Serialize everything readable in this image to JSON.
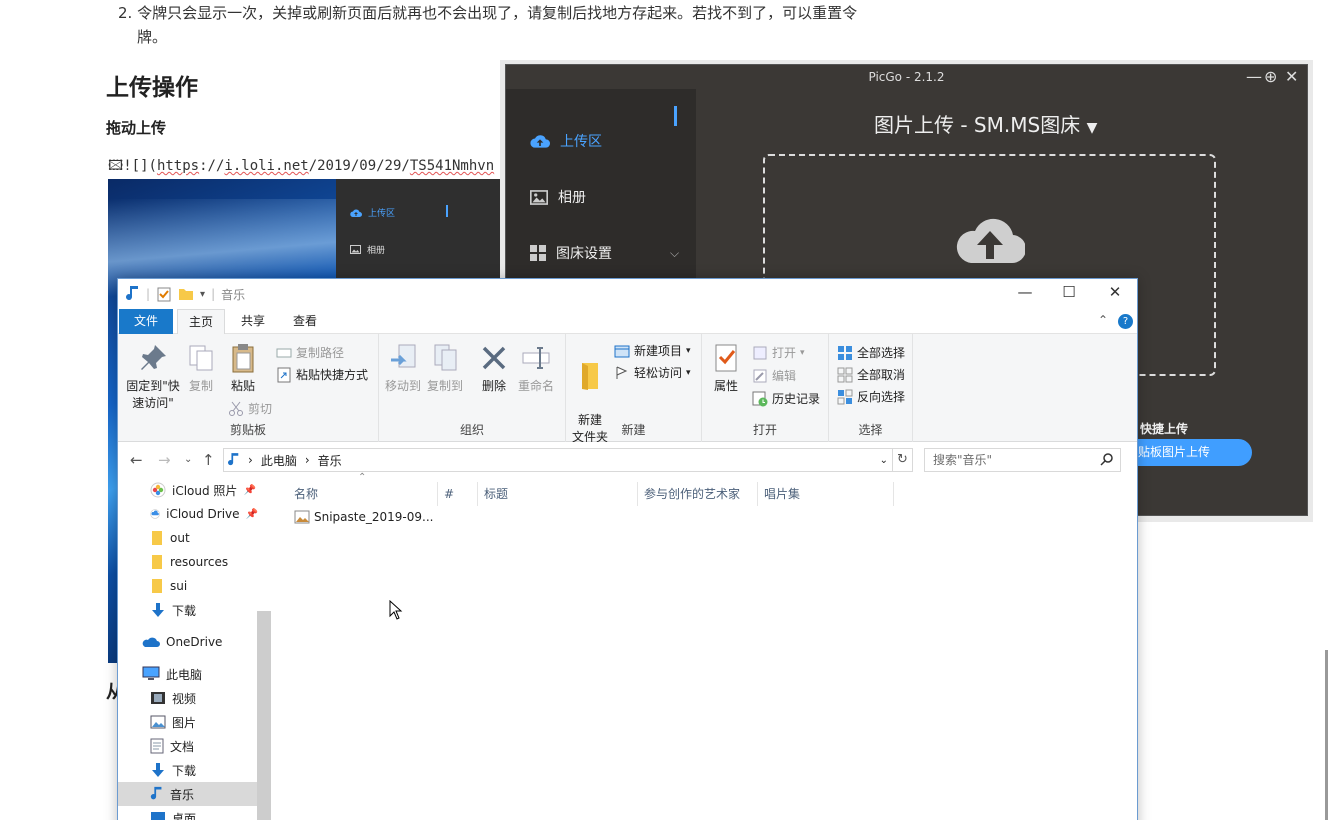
{
  "document": {
    "list_item": "2. 令牌只会显示一次，关掉或刷新页面后就再也不会出现了，请复制后找地方存起来。若找不到了，可以重置令",
    "list_item_cont": "牌。",
    "heading": "上传操作",
    "subheading": "拖动上传",
    "code_prefix": "![](",
    "code_url_a": "https",
    "code_url_sep": "://",
    "code_url_b": "i.loli.net",
    "code_url_path": "/2019/09/29/",
    "code_url_c": "TS541Nmhvn",
    "cut_heading": "从"
  },
  "embedded_shot": {
    "item_upload": "上传区",
    "item_album": "相册"
  },
  "picgo": {
    "title": "PicGo - 2.1.2",
    "controls": {
      "min": "—",
      "max": "⊕",
      "close": "✕"
    },
    "sidebar": [
      {
        "label": "上传区",
        "icon": "cloud-upload-icon"
      },
      {
        "label": "相册",
        "icon": "image-icon"
      },
      {
        "label": "图床设置",
        "icon": "grid-icon",
        "arrow": "⌵"
      }
    ],
    "heading": "图片上传 - SM.MS图床",
    "heading_caret": "▼",
    "shortcut_label": "快捷上传",
    "clipboard_button": "贴板图片上传",
    "accent": "#409eff"
  },
  "explorer": {
    "title": "音乐",
    "window_controls": {
      "min": "—",
      "max": "☐",
      "close": "✕"
    },
    "tabs": [
      "文件",
      "主页",
      "共享",
      "查看"
    ],
    "groups": {
      "clipboard": {
        "label": "剪贴板",
        "pin": "固定到\"快速访问\"",
        "copy": "复制",
        "paste": "粘贴",
        "copy_path": "复制路径",
        "paste_shortcut": "粘贴快捷方式",
        "cut": "剪切"
      },
      "organize": {
        "label": "组织",
        "move_to": "移动到",
        "copy_to": "复制到",
        "delete": "删除",
        "rename": "重命名"
      },
      "new": {
        "label": "新建",
        "new_folder": "新建\n文件夹",
        "new_item": "新建项目",
        "easy_access": "轻松访问"
      },
      "open": {
        "label": "打开",
        "properties": "属性",
        "open": "打开",
        "edit": "编辑",
        "history": "历史记录"
      },
      "select": {
        "label": "选择",
        "select_all": "全部选择",
        "select_none": "全部取消",
        "invert": "反向选择"
      }
    },
    "address": {
      "crumbs": [
        "此电脑",
        "音乐"
      ],
      "separator": "›",
      "search_placeholder": "搜索\"音乐\""
    },
    "nav": [
      {
        "label": "iCloud 照片",
        "icon": "icloud-photos-icon"
      },
      {
        "label": "iCloud Drive",
        "icon": "icloud-drive-icon"
      },
      {
        "label": "out",
        "icon": "folder-icon"
      },
      {
        "label": "resources",
        "icon": "folder-icon"
      },
      {
        "label": "sui",
        "icon": "folder-icon"
      },
      {
        "label": "下载",
        "icon": "download-icon"
      },
      {
        "label": "OneDrive",
        "icon": "onedrive-icon"
      },
      {
        "label": "此电脑",
        "icon": "computer-icon"
      },
      {
        "label": "视频",
        "icon": "video-icon"
      },
      {
        "label": "图片",
        "icon": "pictures-icon"
      },
      {
        "label": "文档",
        "icon": "documents-icon"
      },
      {
        "label": "下载",
        "icon": "download-icon"
      },
      {
        "label": "音乐",
        "icon": "music-icon"
      },
      {
        "label": "桌面",
        "icon": "desktop-icon"
      }
    ],
    "columns": [
      "名称",
      "#",
      "标题",
      "参与创作的艺术家",
      "唱片集"
    ],
    "files": [
      {
        "name": "Snipaste_2019-09..."
      }
    ]
  }
}
